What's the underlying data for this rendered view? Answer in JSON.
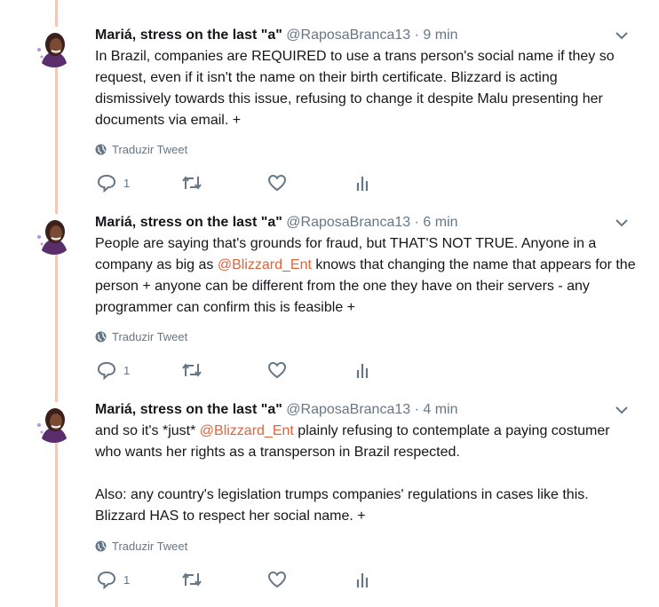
{
  "tweets": [
    {
      "name": "Mariá, stress on the last \"a\"",
      "handle": "@RaposaBranca13",
      "separator": "·",
      "time": "9 min",
      "text_parts": [
        "In Brazil, companies are REQUIRED to use a trans person's social name if they so request, even if it isn't the name on their birth certificate. Blizzard is acting dismissively towards this issue, refusing to change it despite Malu presenting her documents via email. +"
      ],
      "translate_label": "Traduzir Tweet",
      "reply_count": "1"
    },
    {
      "name": "Mariá, stress on the last \"a\"",
      "handle": "@RaposaBranca13",
      "separator": "·",
      "time": "6 min",
      "text_before": "People are saying that's grounds for fraud, but THAT'S NOT TRUE. Anyone in a company as big as ",
      "mention": "@Blizzard_Ent",
      "text_after": " knows that changing the name that appears for the person + anyone can be different from the one they have on their servers - any programmer can confirm this is feasible +",
      "translate_label": "Traduzir Tweet",
      "reply_count": "1"
    },
    {
      "name": "Mariá, stress on the last \"a\"",
      "handle": "@RaposaBranca13",
      "separator": "·",
      "time": "4 min",
      "text_before": "and so it's *just* ",
      "mention": "@Blizzard_Ent",
      "text_after": " plainly refusing to contemplate a paying costumer who wants her rights as a transperson in Brazil respected.\n\nAlso: any country's legislation trumps companies' regulations in cases like this. Blizzard HAS to respect her social name. +",
      "translate_label": "Traduzir Tweet",
      "reply_count": "1"
    }
  ],
  "colors": {
    "thread_line": "#f5c6b5",
    "mention": "#e0633a",
    "muted": "#657786"
  },
  "icons": [
    "globe-icon",
    "reply-icon",
    "retweet-icon",
    "like-icon",
    "analytics-icon",
    "chevron-down-icon"
  ]
}
